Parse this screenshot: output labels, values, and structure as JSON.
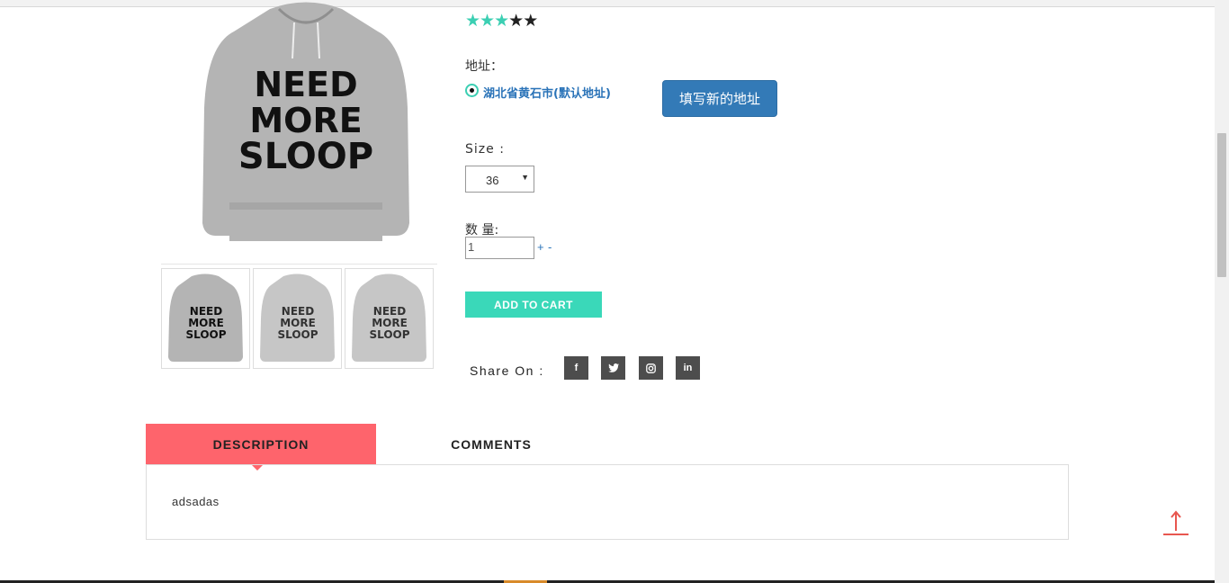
{
  "product": {
    "rating": {
      "value": 3,
      "max": 5
    },
    "main_image": {
      "text_lines": [
        "NEED",
        "MORE",
        "SLOOP"
      ]
    },
    "thumbnails": [
      {
        "text_lines": [
          "NEED",
          "MORE",
          "SLOOP"
        ]
      },
      {
        "text_lines": [
          "NEED",
          "MORE",
          "SLOOP"
        ]
      },
      {
        "text_lines": [
          "NEED",
          "MORE",
          "SLOOP"
        ]
      }
    ]
  },
  "address": {
    "label": "地址：",
    "default_option": "湖北省黄石市(默认地址)",
    "new_address_button": "填写新的地址"
  },
  "size": {
    "label": "Size :",
    "selected": "36"
  },
  "quantity": {
    "label": "数 量:",
    "value": "1",
    "plus": "+",
    "minus": "-"
  },
  "add_to_cart_label": "ADD TO CART",
  "share": {
    "label": "Share On :",
    "icons": [
      "facebook-icon",
      "twitter-icon",
      "instagram-icon",
      "linkedin-icon"
    ],
    "glyphs": [
      "f",
      "t",
      "◎",
      "in"
    ]
  },
  "tabs": {
    "description_label": "DESCRIPTION",
    "comments_label": "COMMENTS",
    "active": "description",
    "description_content": "adsadas"
  },
  "colors": {
    "accent_teal": "#3ad8b9",
    "tab_active": "#fe646c",
    "primary_button": "#337ab7",
    "social_bg": "#4d4d4d",
    "back_to_top": "#e8564f"
  }
}
